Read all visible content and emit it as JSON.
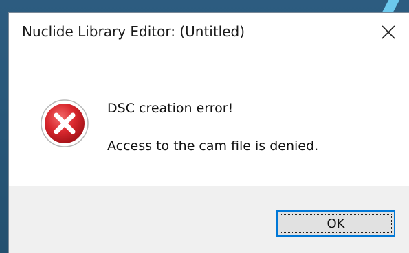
{
  "window": {
    "title": "Nuclide Library Editor: (Untitled)"
  },
  "message": {
    "icon": "error-icon",
    "title": "DSC creation error!",
    "body": "Access to the cam file is denied."
  },
  "buttons": {
    "ok_label": "OK"
  },
  "colors": {
    "error_red": "#d9282e",
    "button_focus": "#0078d7",
    "footer_bg": "#f0f0f0"
  }
}
